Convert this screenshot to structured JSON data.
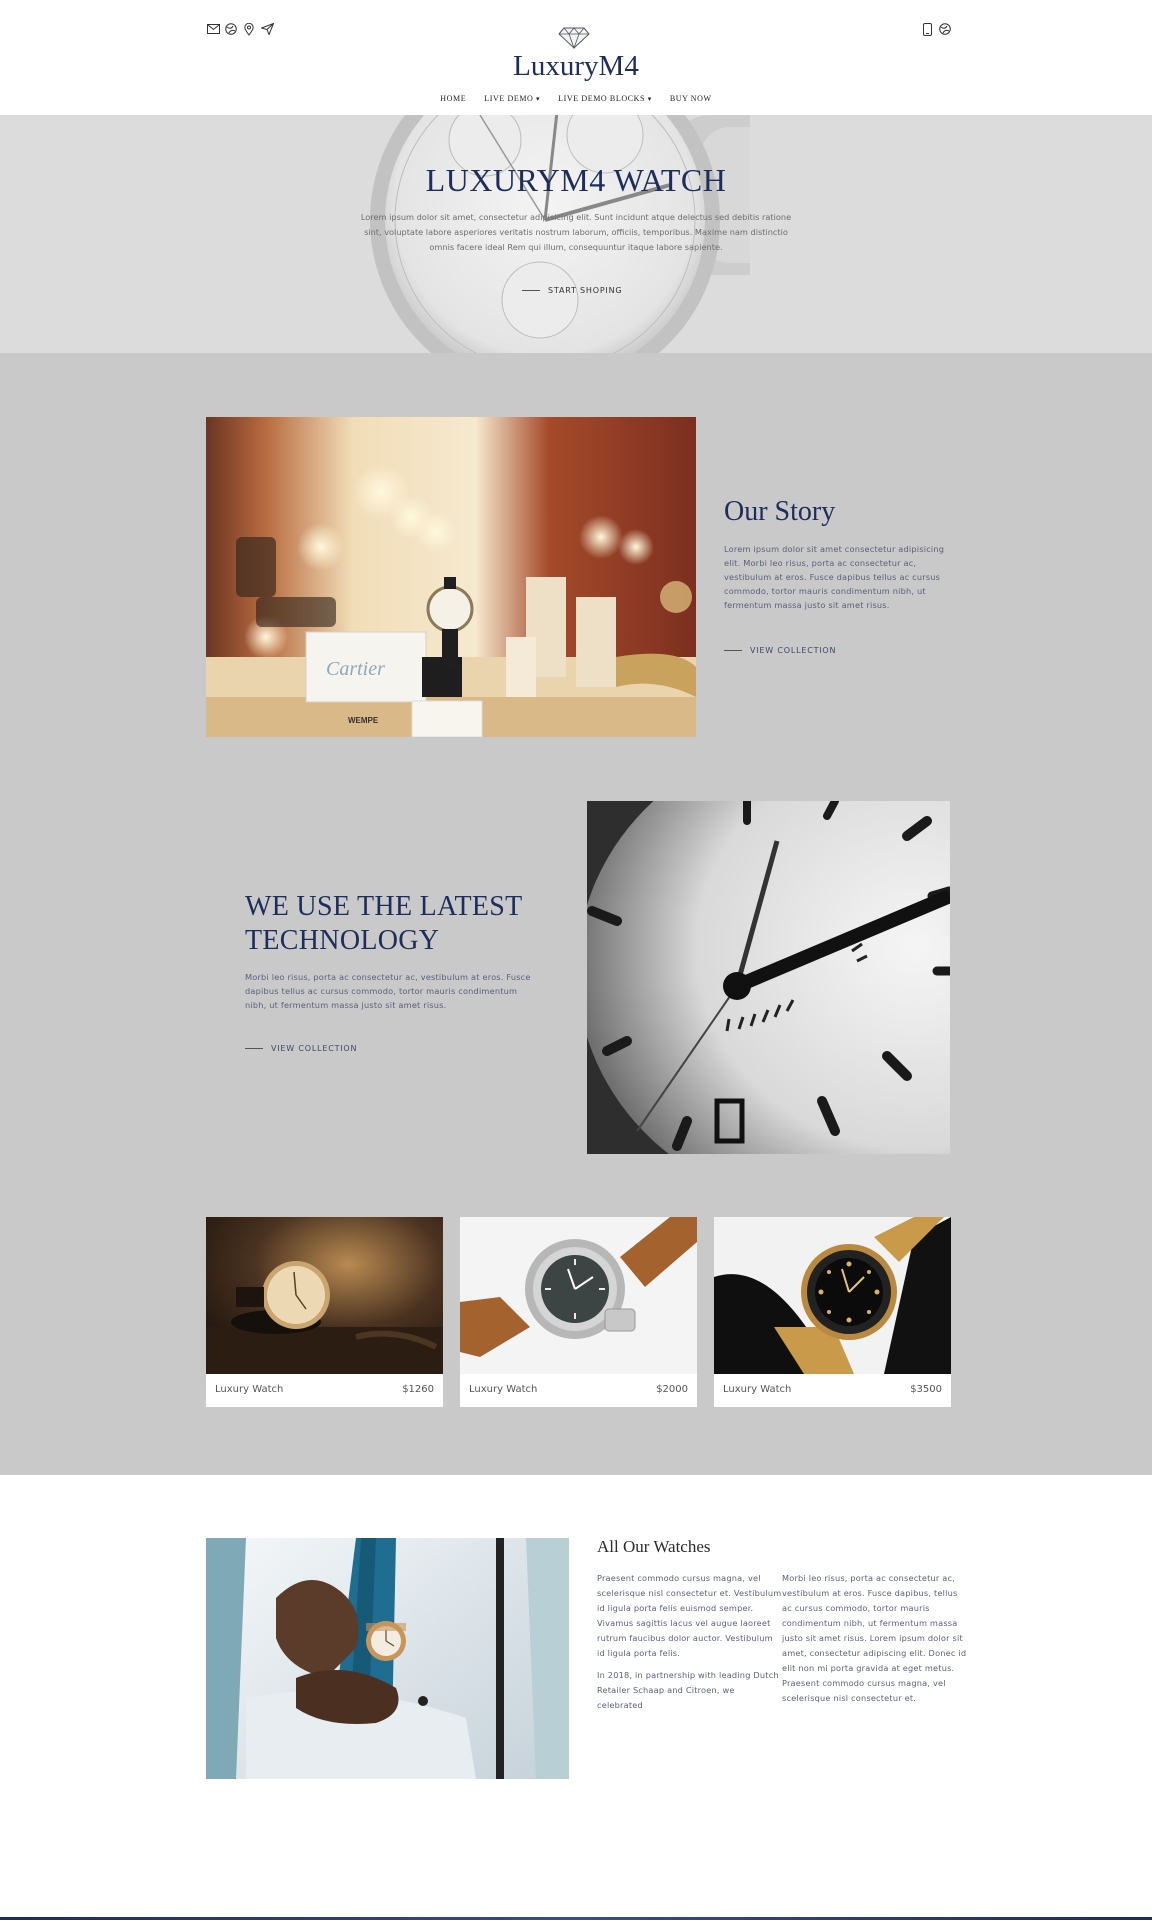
{
  "header": {
    "logo": "LuxuryM4",
    "left_icons": [
      "mail-icon",
      "globe-icon",
      "location-icon",
      "send-icon"
    ],
    "right_icons": [
      "phone-icon",
      "globe-icon"
    ],
    "nav": [
      {
        "label": "HOME",
        "dropdown": false
      },
      {
        "label": "LIVE DEMO",
        "dropdown": true
      },
      {
        "label": "LIVE DEMO BLOCKS",
        "dropdown": true
      },
      {
        "label": "BUY NOW",
        "dropdown": false
      }
    ]
  },
  "hero": {
    "title": "LUXURYM4 WATCH",
    "text": "Lorem ipsum dolor sit amet, consectetur adipisicing elit. Sunt incidunt atque delectus sed debitis ratione sint, voluptate labore asperiores veritatis nostrum laborum, officiis, temporibus. Maxime nam distinctio omnis facere ideal Rem qui illum, consequuntur itaque labore sapiente.",
    "link": "START SHOPING"
  },
  "story": {
    "title": "Our Story",
    "text": "Lorem ipsum dolor sit amet consectetur adipisicing elit. Morbi leo risus, porta ac consectetur ac, vestibulum at eros. Fusce dapibus tellus ac cursus commodo, tortor mauris condimentum nibh, ut fermentum massa justo sit amet risus.",
    "link": "VIEW COLLECTION"
  },
  "technology": {
    "title": "WE USE THE LATEST TECHNOLOGY",
    "text": "Morbi leo risus, porta ac consectetur ac, vestibulum at eros. Fusce dapibus tellus ac cursus commodo, tortor mauris condimentum nibh, ut fermentum massa justo sit amet risus.",
    "link": "VIEW COLLECTION"
  },
  "products": [
    {
      "name": "Luxury Watch",
      "price": "$1260"
    },
    {
      "name": "Luxury Watch",
      "price": "$2000"
    },
    {
      "name": "Luxury Watch",
      "price": "$3500"
    }
  ],
  "all_watches": {
    "title": "All Our Watches",
    "col1_p1": "Praesent commodo cursus magna, vel scelerisque nisl consectetur et. Vestibulum id ligula porta felis euismod semper. Vivamus sagittis lacus vel augue laoreet rutrum faucibus dolor auctor. Vestibulum id ligula porta felis.",
    "col1_p2": "In 2018, in partnership with leading Dutch Retailer Schaap and Citroen, we celebrated",
    "col2_p1": "Morbi leo risus, porta ac consectetur ac, vestibulum at eros. Fusce dapibus, tellus ac cursus commodo, tortor mauris condimentum nibh, ut fermentum massa justo sit amet risus. Lorem ipsum dolor sit amet, consectetur adipiscing elit. Donec id elit non mi porta gravida at eget metus. Praesent commodo cursus magna, vel scelerisque nisl consectetur et."
  },
  "colors": {
    "accent": "#1f2d5c",
    "section_grey": "#c9c9c9",
    "hero_bg": "#dcdcdc"
  }
}
